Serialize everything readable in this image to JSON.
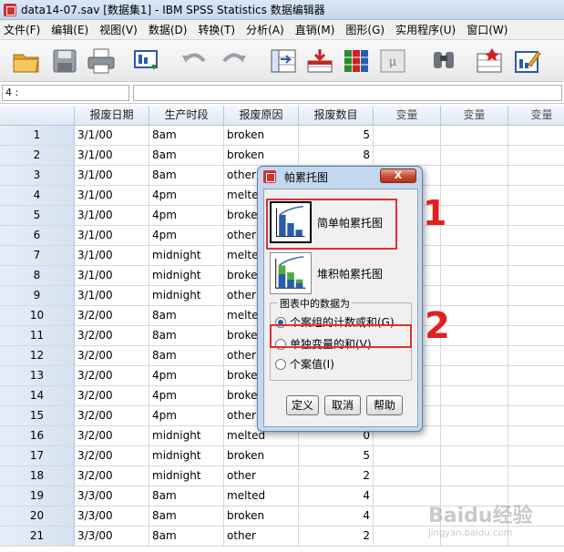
{
  "window": {
    "title": "data14-07.sav [数据集1] - IBM SPSS Statistics 数据编辑器"
  },
  "menu": [
    "文件(F)",
    "编辑(E)",
    "视图(V)",
    "数据(D)",
    "转换(T)",
    "分析(A)",
    "直销(M)",
    "图形(G)",
    "实用程序(U)",
    "窗口(W)"
  ],
  "toolbar": [
    "open-icon",
    "save-icon",
    "print-icon",
    "dialog-recall-icon",
    "undo-icon",
    "redo-icon",
    "goto-case-icon",
    "goto-variable-icon",
    "variables-icon",
    "run-descriptives-icon",
    "find-icon",
    "insert-cases-icon",
    "insert-variable-icon"
  ],
  "cell_editor": {
    "ref": "4 :",
    "value": ""
  },
  "grid": {
    "columns": [
      "报废日期",
      "生产时段",
      "报废原因",
      "报废数目",
      "变量",
      "变量",
      "变量"
    ],
    "rows": [
      [
        "1",
        "3/1/00",
        "8am",
        "broken",
        "5"
      ],
      [
        "2",
        "3/1/00",
        "8am",
        "broken",
        "8"
      ],
      [
        "3",
        "3/1/00",
        "8am",
        "other",
        ""
      ],
      [
        "4",
        "3/1/00",
        "4pm",
        "melte",
        ""
      ],
      [
        "5",
        "3/1/00",
        "4pm",
        "broke",
        ""
      ],
      [
        "6",
        "3/1/00",
        "4pm",
        "other",
        ""
      ],
      [
        "7",
        "3/1/00",
        "midnight",
        "melte",
        ""
      ],
      [
        "8",
        "3/1/00",
        "midnight",
        "broke",
        ""
      ],
      [
        "9",
        "3/1/00",
        "midnight",
        "other",
        ""
      ],
      [
        "10",
        "3/2/00",
        "8am",
        "melte",
        ""
      ],
      [
        "11",
        "3/2/00",
        "8am",
        "broke",
        ""
      ],
      [
        "12",
        "3/2/00",
        "8am",
        "other",
        ""
      ],
      [
        "13",
        "3/2/00",
        "4pm",
        "broke",
        ""
      ],
      [
        "14",
        "3/2/00",
        "4pm",
        "broke",
        ""
      ],
      [
        "15",
        "3/2/00",
        "4pm",
        "other",
        ""
      ],
      [
        "16",
        "3/2/00",
        "midnight",
        "melted",
        "0"
      ],
      [
        "17",
        "3/2/00",
        "midnight",
        "broken",
        "5"
      ],
      [
        "18",
        "3/2/00",
        "midnight",
        "other",
        "2"
      ],
      [
        "19",
        "3/3/00",
        "8am",
        "melted",
        "4"
      ],
      [
        "20",
        "3/3/00",
        "8am",
        "broken",
        "4"
      ],
      [
        "21",
        "3/3/00",
        "8am",
        "other",
        "2"
      ]
    ]
  },
  "dialog": {
    "title": "帕累托图",
    "close_label": "X",
    "options": [
      {
        "label": "简单帕累托图",
        "selected": true
      },
      {
        "label": "堆积帕累托图",
        "selected": false
      }
    ],
    "group_title": "图表中的数据为",
    "radios": [
      {
        "label": "个案组的计数或和(G)",
        "checked": true
      },
      {
        "label": "单独变量的和(V)",
        "checked": false
      },
      {
        "label": "个案值(I)",
        "checked": false
      }
    ],
    "buttons": [
      "定义",
      "取消",
      "帮助"
    ]
  },
  "annotations": {
    "mark1": "1",
    "mark2": "2",
    "color": "#e03030"
  },
  "watermark": {
    "text": "Baidu经验",
    "sub": "jingyan.baidu.com"
  }
}
